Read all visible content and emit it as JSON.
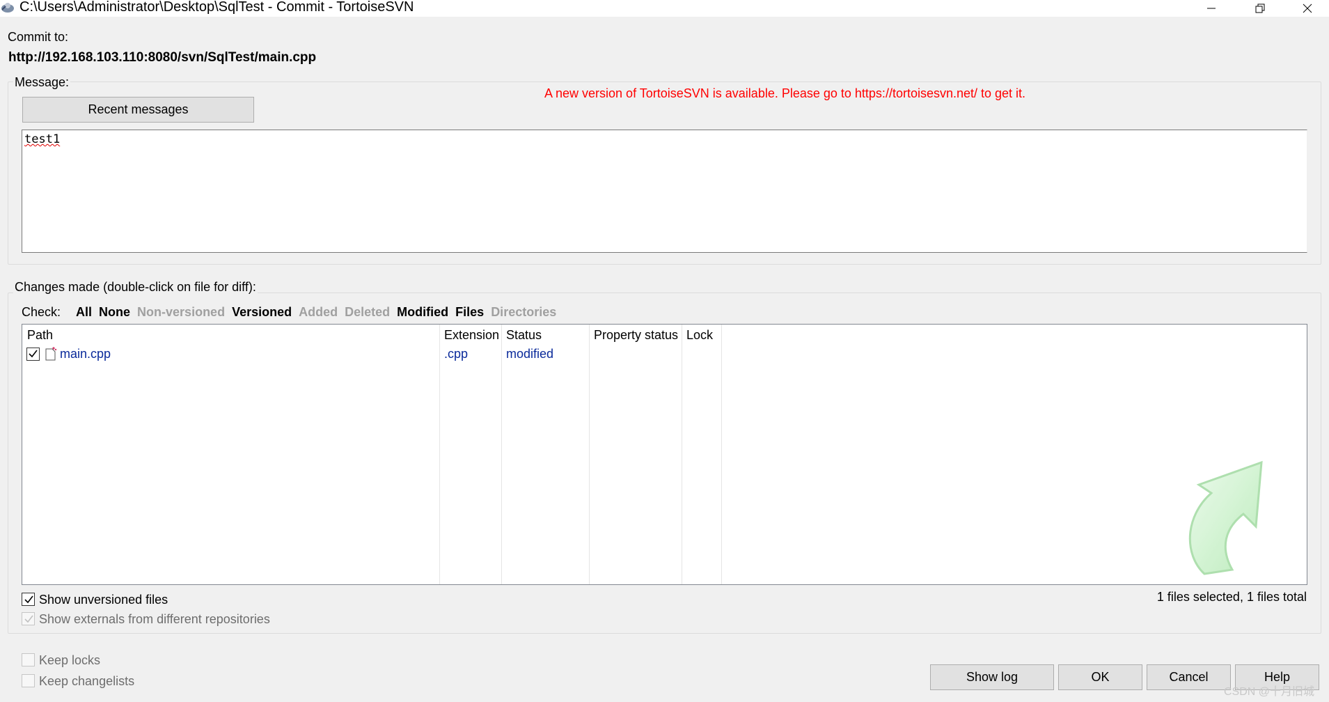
{
  "window": {
    "title": "C:\\Users\\Administrator\\Desktop\\SqlTest - Commit - TortoiseSVN"
  },
  "commit": {
    "label": "Commit to:",
    "url": "http://192.168.103.110:8080/svn/SqlTest/main.cpp"
  },
  "message": {
    "legend": "Message:",
    "recent_button": "Recent messages",
    "update_notice": "A new version of TortoiseSVN is available. Please go to https://tortoisesvn.net/ to get it.",
    "text": "test1"
  },
  "changes": {
    "legend": "Changes made (double-click on file for diff):",
    "check_label": "Check:",
    "filters": [
      {
        "label": "All",
        "enabled": true
      },
      {
        "label": "None",
        "enabled": true
      },
      {
        "label": "Non-versioned",
        "enabled": false
      },
      {
        "label": "Versioned",
        "enabled": true
      },
      {
        "label": "Added",
        "enabled": false
      },
      {
        "label": "Deleted",
        "enabled": false
      },
      {
        "label": "Modified",
        "enabled": true
      },
      {
        "label": "Files",
        "enabled": true
      },
      {
        "label": "Directories",
        "enabled": false
      }
    ],
    "columns": [
      "Path",
      "Extension",
      "Status",
      "Property status",
      "Lock"
    ],
    "rows": [
      {
        "checked": true,
        "path": "main.cpp",
        "extension": ".cpp",
        "status": "modified",
        "property_status": "",
        "lock": ""
      }
    ],
    "summary": "1 files selected, 1 files total"
  },
  "options": {
    "show_unversioned": {
      "label": "Show unversioned files",
      "checked": true
    },
    "show_externals": {
      "label": "Show externals from different repositories",
      "checked": true,
      "disabled": true
    },
    "keep_locks": {
      "label": "Keep locks",
      "checked": false,
      "disabled": true
    },
    "keep_changelists": {
      "label": "Keep changelists",
      "checked": false,
      "disabled": true
    }
  },
  "buttons": {
    "show_log": "Show log",
    "ok": "OK",
    "cancel": "Cancel",
    "help": "Help"
  },
  "watermark": "CSDN @十月旧城",
  "colors": {
    "notice": "#ff0000",
    "list_text": "#0a2a9a",
    "disabled_filter": "#a0a0a0"
  }
}
